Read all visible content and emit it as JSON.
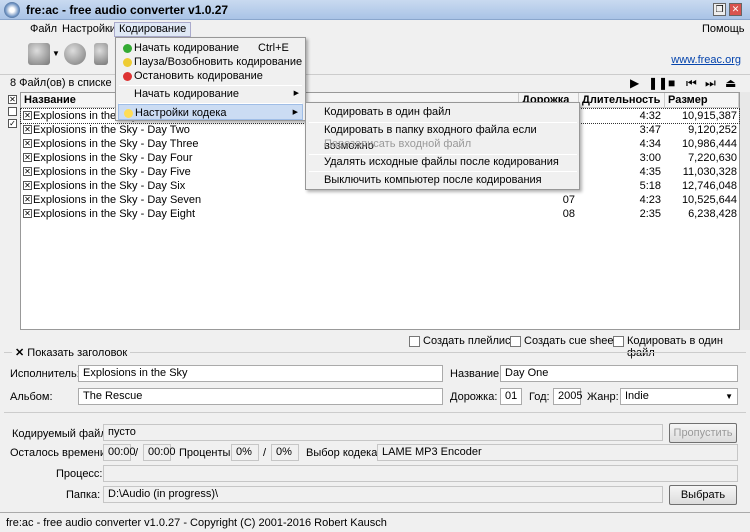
{
  "window": {
    "title": "fre:ac - free audio converter v1.0.27"
  },
  "menubar": {
    "items": [
      "Файл",
      "Настройки",
      "Кодирование"
    ],
    "help": "Помощь"
  },
  "toolbar": {
    "link": "www.freac.org"
  },
  "list": {
    "info": "8 Файл(ов) в списке (3",
    "columns": [
      "Название",
      "Дорожка",
      "Длительность",
      "Размер"
    ],
    "rows": [
      {
        "title": "Explosions in the Sky",
        "track": "",
        "length": "4:32",
        "size": "10,915,387"
      },
      {
        "title": "Explosions in the Sky - Day Two",
        "track": "",
        "length": "3:47",
        "size": "9,120,252"
      },
      {
        "title": "Explosions in the Sky - Day Three",
        "track": "",
        "length": "4:34",
        "size": "10,986,444"
      },
      {
        "title": "Explosions in the Sky - Day Four",
        "track": "",
        "length": "3:00",
        "size": "7,220,630"
      },
      {
        "title": "Explosions in the Sky - Day Five",
        "track": "",
        "length": "4:35",
        "size": "11,030,328"
      },
      {
        "title": "Explosions in the Sky - Day Six",
        "track": "",
        "length": "5:18",
        "size": "12,746,048"
      },
      {
        "title": "Explosions in the Sky - Day Seven",
        "track": "07",
        "length": "4:23",
        "size": "10,525,644"
      },
      {
        "title": "Explosions in the Sky - Day Eight",
        "track": "08",
        "length": "2:35",
        "size": "6,238,428"
      }
    ]
  },
  "encode_menu": {
    "start": "Начать кодирование",
    "start_shortcut": "Ctrl+E",
    "pause": "Пауза/Возобновить кодирование",
    "stop": "Остановить кодирование",
    "start_sub": "Начать кодирование",
    "codec_settings": "Настройки кодека"
  },
  "codec_submenu": {
    "single_file": "Кодировать в один файл",
    "input_folder": "Кодировать в папку входного файла если возможно",
    "overwrite": "Перезаписать входной файл",
    "delete_source": "Удалять исходные файлы после кодирования",
    "shutdown": "Выключить компьютер после кодирования"
  },
  "options": {
    "playlist": "Создать плейлист",
    "cue": "Создать cue sheet",
    "single": "Кодировать в один файл",
    "show_tags": "Показать заголовок"
  },
  "tags": {
    "artist_label": "Исполнитель:",
    "artist": "Explosions in the Sky",
    "title_label": "Название:",
    "title": "Day One",
    "album_label": "Альбом:",
    "album": "The Rescue",
    "track_label": "Дорожка:",
    "track": "01",
    "year_label": "Год:",
    "year": "2005",
    "genre_label": "Жанр:",
    "genre": "Indie"
  },
  "progress": {
    "file_label": "Кодируемый файл:",
    "file": "пусто",
    "skip": "Пропустить",
    "time_label": "Осталось времени:",
    "time_left": "00:00",
    "time_total": "00:00",
    "slash": "/",
    "percent_label": "Проценты:",
    "p1": "0%",
    "p2": "0%",
    "codec_label": "Выбор кодека:",
    "codec": "LAME MP3 Encoder",
    "process_label": "Процесс:",
    "folder_label": "Папка:",
    "folder": "D:\\Audio (in progress)\\",
    "browse": "Выбрать"
  },
  "statusbar": "fre:ac - free audio converter v1.0.27 - Copyright (C) 2001-2016 Robert Kausch"
}
